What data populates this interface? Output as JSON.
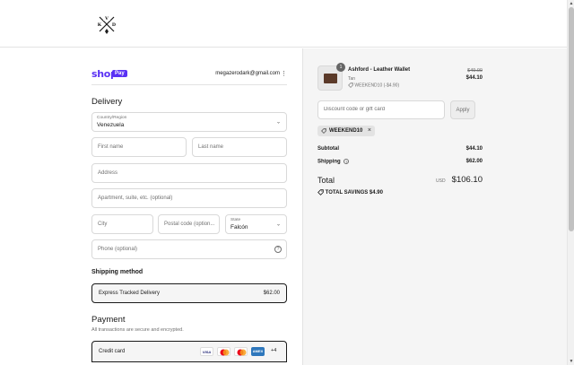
{
  "header": {
    "logo_letters": {
      "top": "V",
      "left": "K",
      "right": "D"
    }
  },
  "express": {
    "shop_label": "shop",
    "pay_label": "Pay",
    "email": "megazerodark@gmail.com"
  },
  "delivery": {
    "title": "Delivery",
    "country_label": "Country/Region",
    "country_value": "Venezuela",
    "first_name_placeholder": "First name",
    "last_name_placeholder": "Last name",
    "address_placeholder": "Address",
    "apartment_placeholder": "Apartment, suite, etc. (optional)",
    "city_placeholder": "City",
    "postal_placeholder": "Postal code (option...",
    "state_label": "State",
    "state_value": "Falcón",
    "phone_placeholder": "Phone (optional)"
  },
  "shipping": {
    "title": "Shipping method",
    "option_name": "Express Tracked Delivery",
    "option_price": "$62.00"
  },
  "payment": {
    "title": "Payment",
    "note": "All transactions are secure and encrypted.",
    "method": "Credit card",
    "cards": [
      "VISA",
      "mastercard",
      "maestro",
      "AMEX"
    ],
    "more_cards": "+4"
  },
  "summary": {
    "product": {
      "quantity": "1",
      "name": "Ashford - Leather Wallet",
      "variant": "Tan",
      "discount_note": "WEEKEND10 (-$4.90)",
      "original_price": "$49.00",
      "price": "$44.10"
    },
    "discount_placeholder": "Discount code or gift card",
    "apply_label": "Apply",
    "applied_code": "WEEKEND10",
    "subtotal_label": "Subtotal",
    "subtotal_value": "$44.10",
    "shipping_label": "Shipping",
    "shipping_value": "$62.00",
    "total_label": "Total",
    "currency": "USD",
    "total_value": "$106.10",
    "savings_label": "TOTAL SAVINGS",
    "savings_value": "$4.90"
  },
  "colors": {
    "shop_pay": "#5a31f4",
    "summary_bg": "#f5f5f5"
  }
}
